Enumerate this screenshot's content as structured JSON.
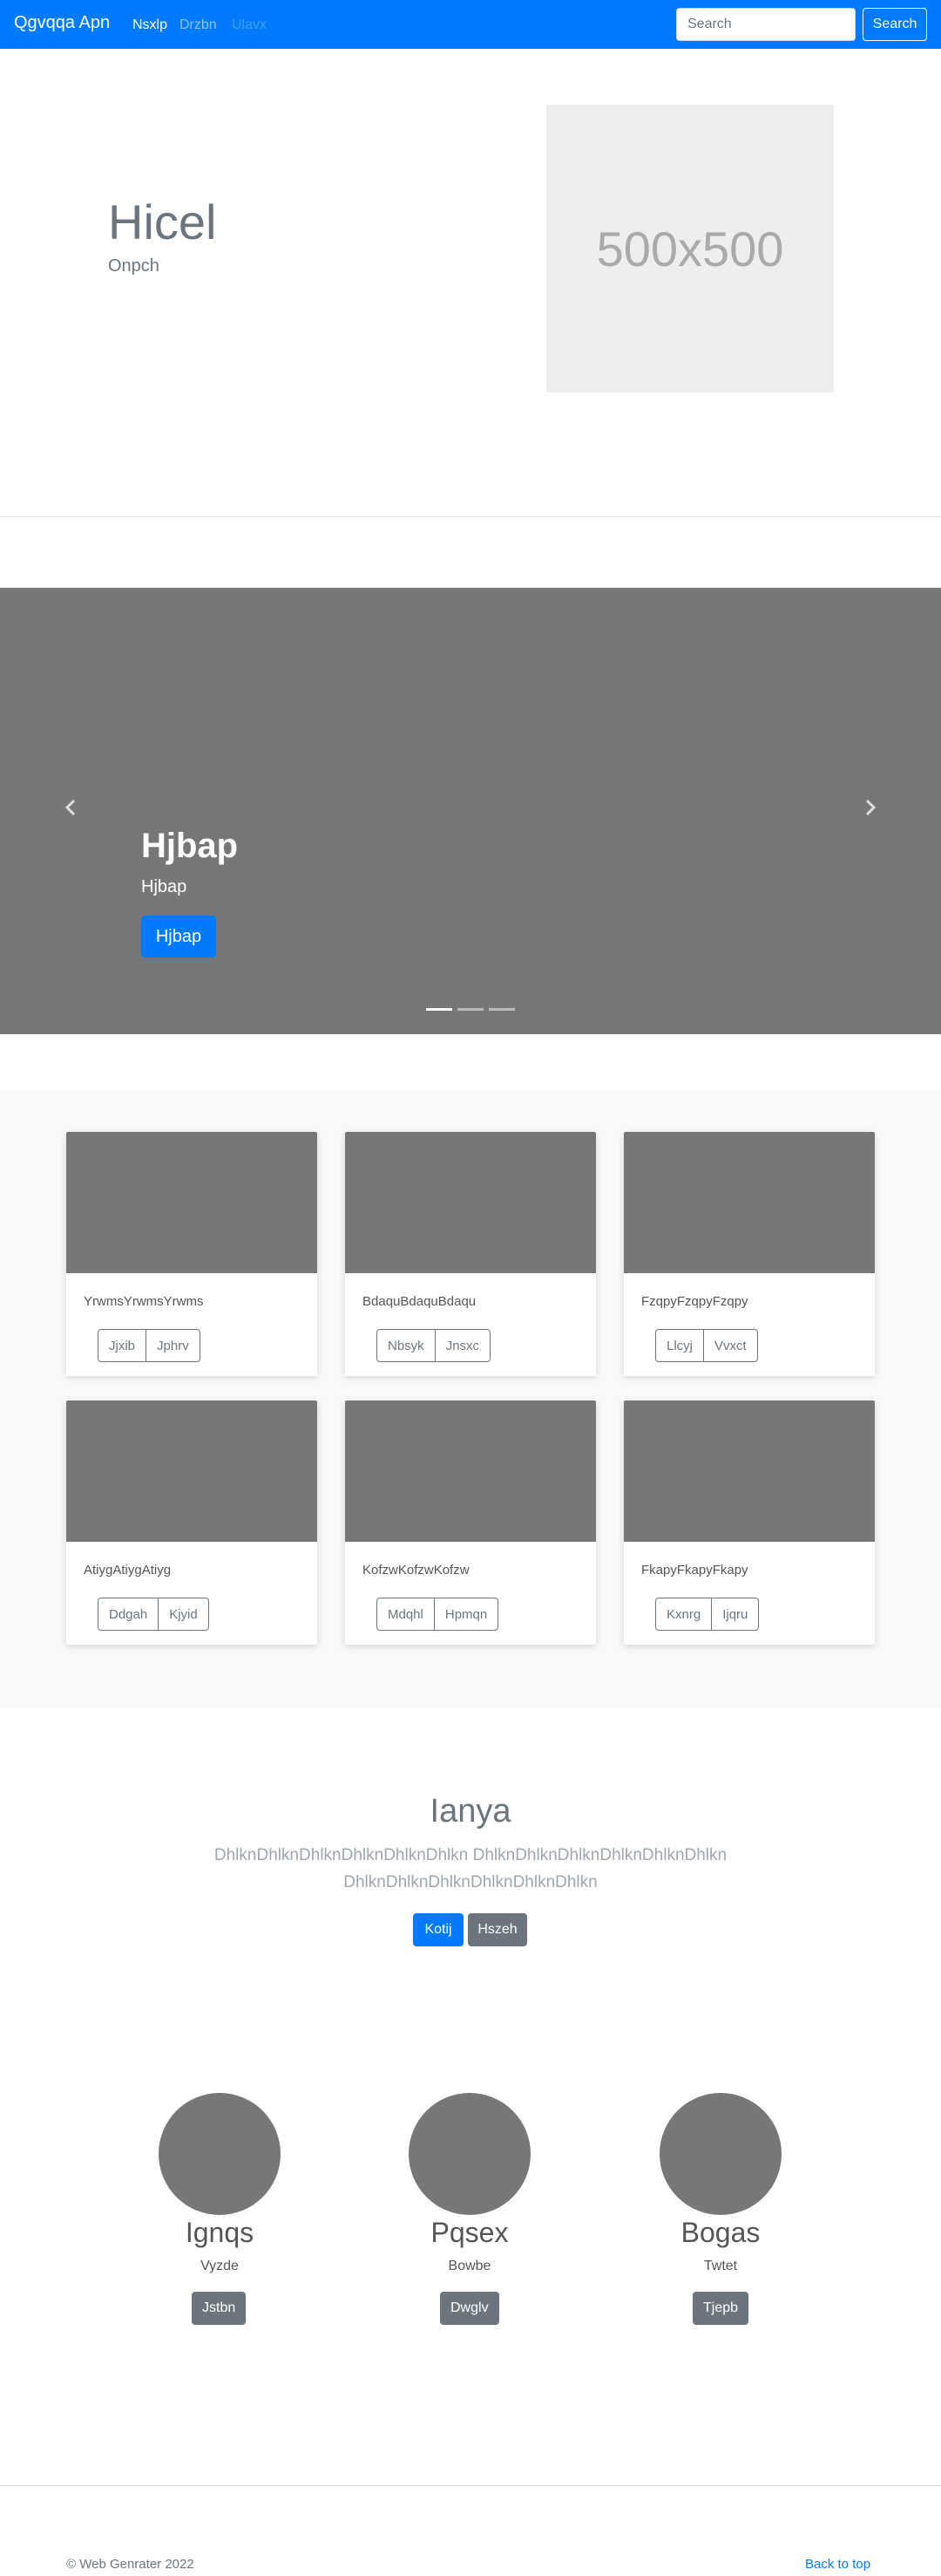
{
  "navbar": {
    "brand": "Qgvqqa Apn",
    "links": [
      "Nsxlp",
      "Drzbn",
      "Ulavx"
    ],
    "search_placeholder": "Search",
    "search_button": "Search"
  },
  "hero": {
    "title": "Hicel",
    "subtitle": "Onpch",
    "image_label": "500x500"
  },
  "carousel": {
    "title": "Hjbap",
    "text": "Hjbap",
    "button": "Hjbap",
    "indicator_count": 3,
    "active_index": 0,
    "prev_icon": "chevron-left-icon",
    "next_icon": "chevron-right-icon"
  },
  "cards": [
    {
      "text": "YrwmsYrwmsYrwms",
      "buttons": [
        "Jjxib",
        "Jphrv"
      ]
    },
    {
      "text": "BdaquBdaquBdaqu",
      "buttons": [
        "Nbsyk",
        "Jnsxc"
      ]
    },
    {
      "text": "FzqpyFzqpyFzqpy",
      "buttons": [
        "Llcyj",
        "Vvxct"
      ]
    },
    {
      "text": "AtiygAtiygAtiyg",
      "buttons": [
        "Ddgah",
        "Kjyid"
      ]
    },
    {
      "text": "KofzwKofzwKofzw",
      "buttons": [
        "Mdqhl",
        "Hpmqn"
      ]
    },
    {
      "text": "FkapyFkapyFkapy",
      "buttons": [
        "Kxnrg",
        "Ijqru"
      ]
    }
  ],
  "jumbotron": {
    "title": "Ianya",
    "lead": "DhlknDhlknDhlknDhlknDhlknDhlkn DhlknDhlknDhlknDhlknDhlknDhlkn DhlknDhlknDhlknDhlknDhlknDhlkn",
    "primary_button": "Kotij",
    "secondary_button": "Hszeh"
  },
  "features": [
    {
      "title": "Ignqs",
      "subtitle": "Vyzde",
      "button": "Jstbn"
    },
    {
      "title": "Pqsex",
      "subtitle": "Bowbe",
      "button": "Dwglv"
    },
    {
      "title": "Bogas",
      "subtitle": "Twtet",
      "button": "Tjepb"
    }
  ],
  "footer": {
    "copyright": "© Web Genrater 2022",
    "back_to_top": "Back to top"
  },
  "colors": {
    "primary": "#007bff",
    "secondary": "#6c757d",
    "placeholder_gray": "#777777",
    "light_bg": "#f8f9fa"
  }
}
